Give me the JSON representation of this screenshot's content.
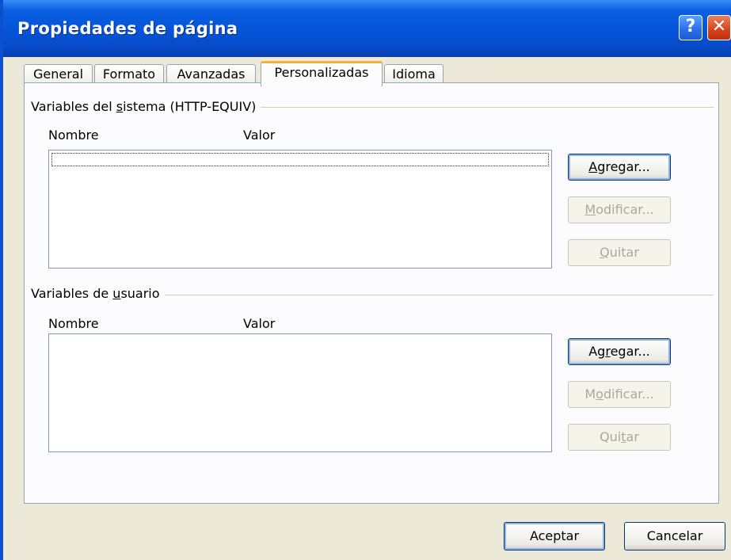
{
  "window": {
    "title": "Propiedades de página",
    "help_glyph": "?",
    "close_glyph": "✕"
  },
  "tabs": [
    {
      "label": "General"
    },
    {
      "label": "Formato"
    },
    {
      "label": "Avanzadas"
    },
    {
      "label": "Personalizadas"
    },
    {
      "label": "Idioma"
    }
  ],
  "system_vars": {
    "group_pre": "Variables del ",
    "group_accel": "s",
    "group_post": "istema (HTTP-EQUIV)",
    "col_name": "Nombre",
    "col_value": "Valor",
    "add": {
      "accel": "A",
      "rest": "gregar..."
    },
    "modify": {
      "accel": "M",
      "rest": "odificar..."
    },
    "remove": {
      "accel": "Q",
      "rest": "uitar"
    }
  },
  "user_vars": {
    "group_pre": "Variables de ",
    "group_accel": "u",
    "group_post": "suario",
    "col_name": "Nombre",
    "col_value": "Valor",
    "add": {
      "pre": "Ag",
      "accel": "r",
      "rest": "egar..."
    },
    "modify": {
      "pre": "M",
      "accel": "o",
      "rest": "dificar..."
    },
    "remove": {
      "pre": "Qui",
      "accel": "t",
      "rest": "ar"
    }
  },
  "footer": {
    "ok_label": "Aceptar",
    "cancel_label": "Cancelar"
  },
  "colors": {
    "titlebar": "#0454d9",
    "dialog_bg": "#ece9d8",
    "active_tab_accent": "#f5b040",
    "disabled_text": "#aca899"
  }
}
